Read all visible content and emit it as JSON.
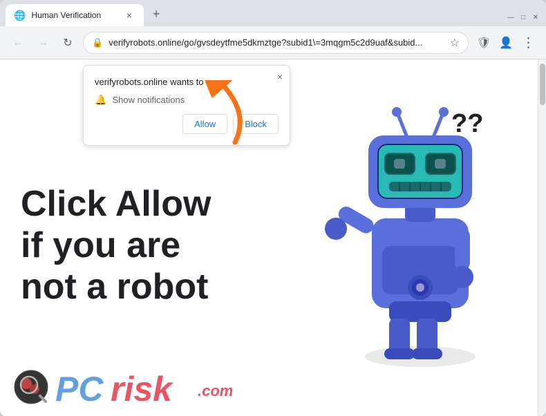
{
  "browser": {
    "tab": {
      "title": "Human Verification",
      "favicon_label": "globe-icon"
    },
    "new_tab_label": "+",
    "window_controls": {
      "minimize": "—",
      "maximize": "□",
      "close": "✕"
    },
    "nav": {
      "back": "←",
      "forward": "→",
      "refresh": "↻"
    },
    "url": "verifyrobots.online/go/gvsdeytfme5dkmztge?subid1\\=3mqgm5c2d9uaf&subid...",
    "toolbar": {
      "bookmark": "☆",
      "profile": "👤",
      "menu": "⋮",
      "extension": "🛡"
    }
  },
  "popup": {
    "domain_text": "verifyrobots.online wants to",
    "notification_label": "Show notifications",
    "allow_btn": "Allow",
    "block_btn": "Block",
    "close_symbol": "×"
  },
  "page": {
    "main_text": "Click Allow if you are not a robot",
    "arrow_hint": "↗"
  },
  "watermark": {
    "pc_text": "PC",
    "risk_text": "risk",
    "dot_com": ".com"
  },
  "colors": {
    "orange_arrow": "#f97316",
    "robot_body": "#5b6fdb",
    "robot_dark": "#3a4bbb",
    "robot_screen": "#2dd4bf",
    "background": "#ffffff",
    "text_dark": "#202124"
  }
}
